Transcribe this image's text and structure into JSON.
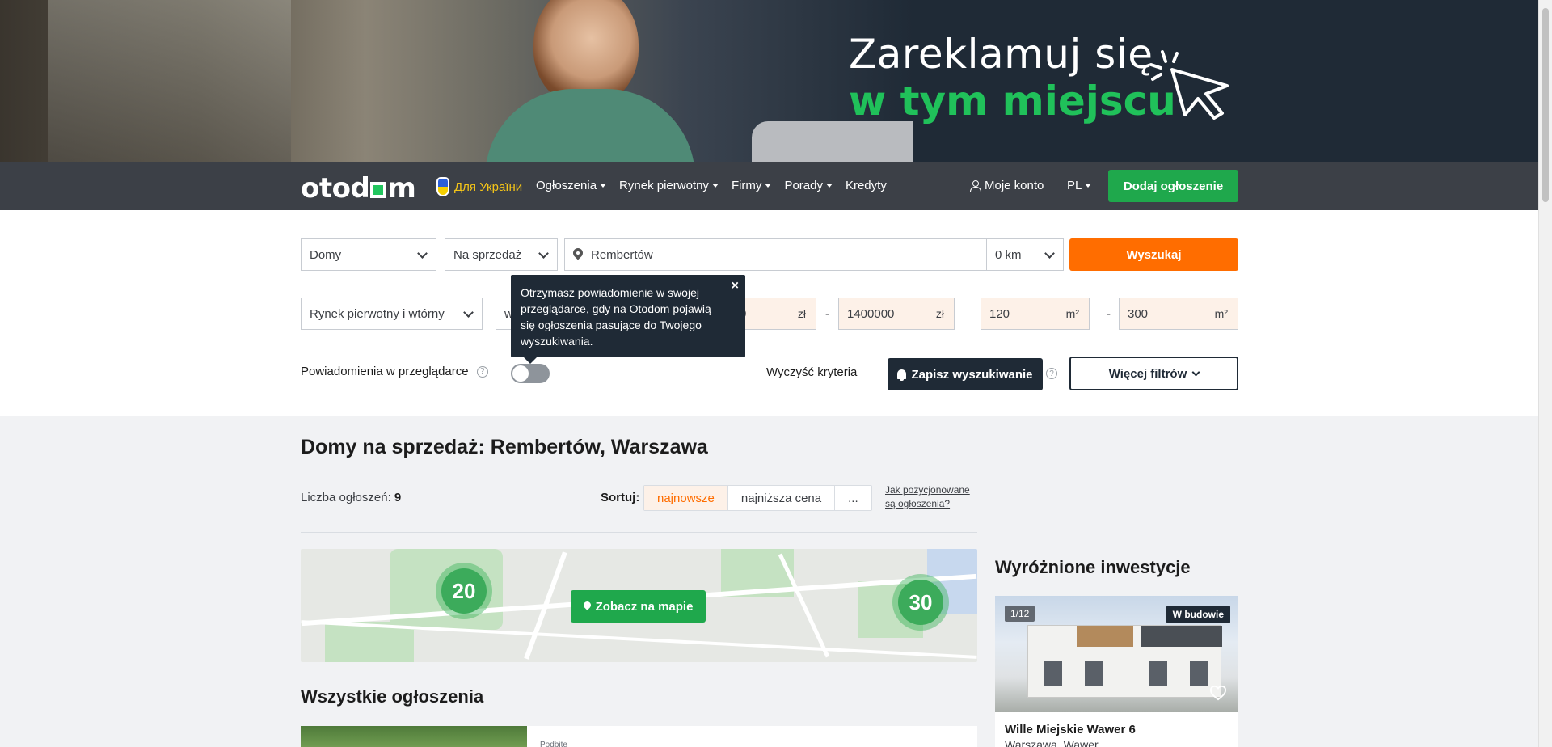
{
  "banner": {
    "line1": "Zareklamuj się",
    "line2": "w tym miejscu",
    "accent": "#20c15a"
  },
  "nav": {
    "logo": "otodom",
    "ukraine_link": "Для України",
    "items": [
      {
        "label": "Ogłoszenia"
      },
      {
        "label": "Rynek pierwotny"
      },
      {
        "label": "Firmy"
      },
      {
        "label": "Porady"
      },
      {
        "label": "Kredyty"
      }
    ],
    "account": "Moje konto",
    "language": "PL",
    "add_listing": "Dodaj ogłoszenie"
  },
  "search": {
    "property_type": "Domy",
    "transaction": "Na sprzedaż",
    "location": "Rembertów",
    "radius": "0 km",
    "search_button": "Wyszukaj",
    "market": "Rynek pierwotny i wtórny",
    "fragment_field": "w",
    "price_from": "0",
    "price_to": "1400000",
    "price_unit": "zł",
    "area_from": "120",
    "area_to": "300",
    "area_unit": "m²",
    "range_separator": "-",
    "browser_notifications_label": "Powiadomienia w przeglądarce",
    "clear_criteria": "Wyczyść kryteria",
    "save_search": "Zapisz wyszukiwanie",
    "more_filters": "Więcej filtrów"
  },
  "tooltip": {
    "text": "Otrzymasz powiadomienie w swojej przeglądarce, gdy na Otodom pojawią się ogłoszenia pasujące do Twojego wyszukiwania.",
    "close": "×"
  },
  "results": {
    "title": "Domy na sprzedaż: Rembertów, Warszawa",
    "count_label": "Liczba ogłoszeń:",
    "count_value": "9",
    "sort_label": "Sortuj:",
    "sort_options": [
      "najnowsze",
      "najniższa cena",
      "..."
    ],
    "positioning_link": "Jak pozycjonowane są ogłoszenia?",
    "map_clusters": [
      "20",
      "30"
    ],
    "map_button": "Zobacz na mapie",
    "all_listings_title": "Wszystkie ogłoszenia",
    "first_listing_type": "Podbite"
  },
  "featured": {
    "title": "Wyróżnione inwestycje",
    "photo_counter": "1/12",
    "status_badge": "W budowie",
    "name": "Wille Miejskie Wawer 6",
    "location": "Warszawa, Wawer"
  },
  "colors": {
    "nav_bg": "#3c4047",
    "green": "#1fa84c",
    "orange": "#ff6d00",
    "dark": "#1f2a36"
  }
}
